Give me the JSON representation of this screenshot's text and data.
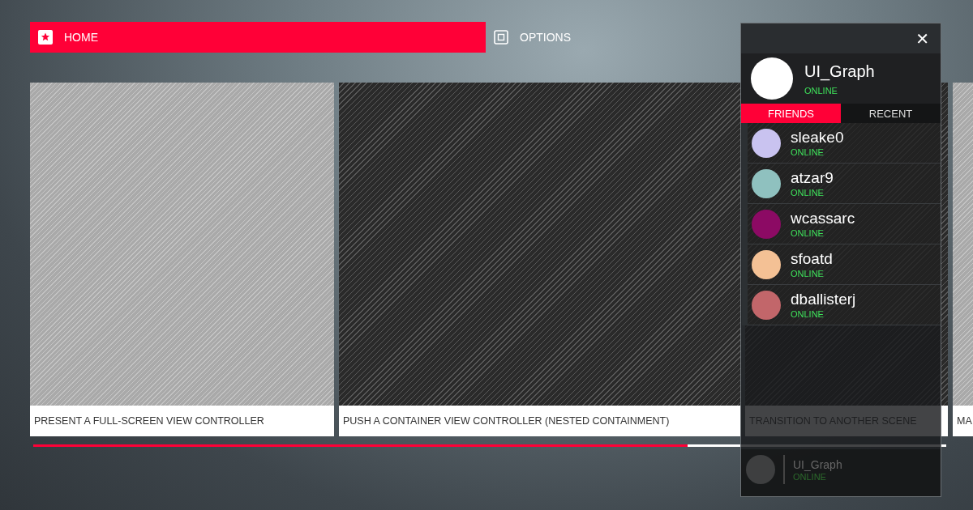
{
  "nav": [
    {
      "label": "HOME",
      "kind": "star",
      "selected": true
    },
    {
      "label": "OPTIONS",
      "kind": "square",
      "selected": false
    }
  ],
  "cards": [
    {
      "title": "PRESENT A FULL-SCREEN VIEW CONTROLLER",
      "kind": "light"
    },
    {
      "title": "PUSH A CONTAINER VIEW CONTROLLER (NESTED CONTAINMENT)",
      "kind": "dark"
    },
    {
      "title": "TRANSITION TO ANOTHER SCENE",
      "kind": "dark"
    },
    {
      "title": "MA",
      "kind": "light"
    }
  ],
  "progress": {
    "level": 0.717
  },
  "panel": {
    "close": "✕",
    "profile": {
      "name": "UI_Graph",
      "status": "ONLINE"
    },
    "tabs": [
      {
        "label": "FRIENDS",
        "selected": true
      },
      {
        "label": "RECENT",
        "selected": false
      }
    ],
    "friends": [
      {
        "name": "sleake0",
        "status": "ONLINE",
        "color": "#c9c3f0"
      },
      {
        "name": "atzar9",
        "status": "ONLINE",
        "color": "#8fc1bf"
      },
      {
        "name": "wcassarc",
        "status": "ONLINE",
        "color": "#8c0a64"
      },
      {
        "name": "sfoatd",
        "status": "ONLINE",
        "color": "#f4c195"
      },
      {
        "name": "dballisterj",
        "status": "ONLINE",
        "color": "#c2666a"
      }
    ],
    "footer": {
      "name": "UI_Graph",
      "status": "ONLINE"
    }
  }
}
